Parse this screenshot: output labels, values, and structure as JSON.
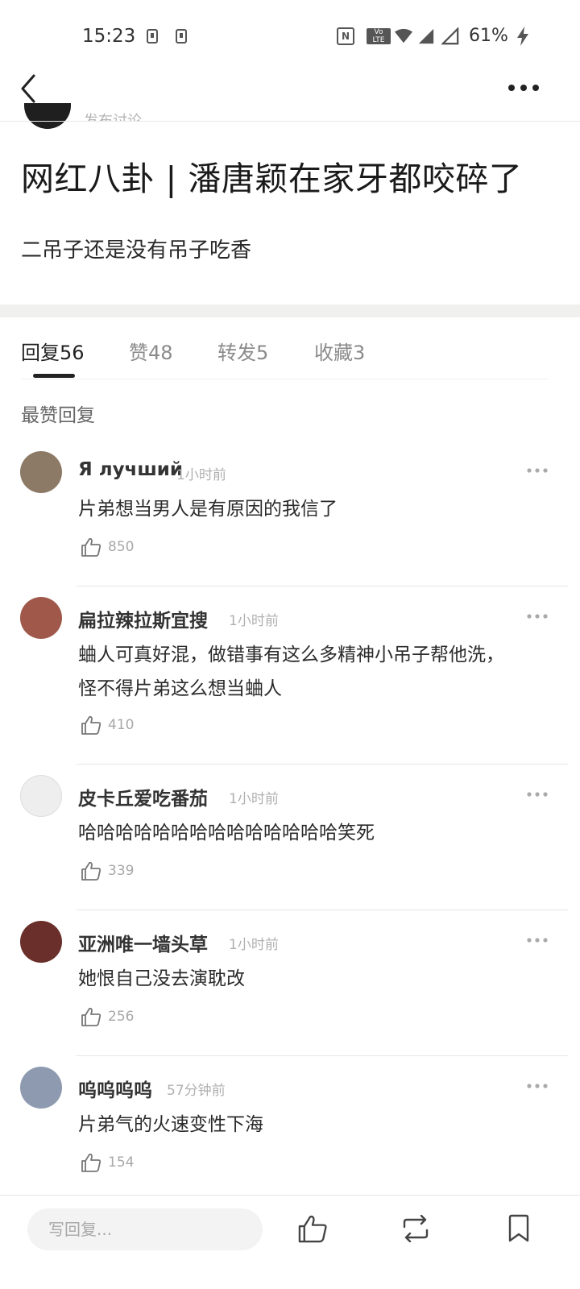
{
  "status_bar": {
    "time": "15:23",
    "nfc": "N",
    "volte_top": "Vo",
    "volte_bottom": "LTE",
    "battery": "61%"
  },
  "author": {
    "subtitle": "发布讨论"
  },
  "post": {
    "title": "网红八卦 | 潘唐颖在家牙都咬碎了",
    "body": "二吊子还是没有吊子吃香"
  },
  "tabs": [
    {
      "label": "回复",
      "count": "56"
    },
    {
      "label": "赞",
      "count": "48"
    },
    {
      "label": "转发",
      "count": "5"
    },
    {
      "label": "收藏",
      "count": "3"
    }
  ],
  "section_label": "最赞回复",
  "comments": [
    {
      "name": "Я лучший",
      "time": "1小时前",
      "text": "片弟想当男人是有原因的我信了",
      "likes": "850",
      "avatar_color": "#8c7a66"
    },
    {
      "name": "扁拉辣拉斯宜搜",
      "time": "1小时前",
      "text": "蛐人可真好混，做错事有这么多精神小吊子帮他洗，怪不得片弟这么想当蛐人",
      "likes": "410",
      "avatar_color": "#a0584a"
    },
    {
      "name": "皮卡丘爱吃番茄",
      "time": "1小时前",
      "text": "哈哈哈哈哈哈哈哈哈哈哈哈哈哈笑死",
      "likes": "339",
      "avatar_color": "#eeeeee"
    },
    {
      "name": "亚洲唯一墙头草",
      "time": "1小时前",
      "text": "她恨自己没去演耽改",
      "likes": "256",
      "avatar_color": "#6a2f2a"
    },
    {
      "name": "呜呜呜呜",
      "time": "57分钟前",
      "text": "片弟气的火速变性下海",
      "likes": "154",
      "avatar_color": "#8e9ab0"
    }
  ],
  "bottom_bar": {
    "reply_placeholder": "写回复..."
  }
}
